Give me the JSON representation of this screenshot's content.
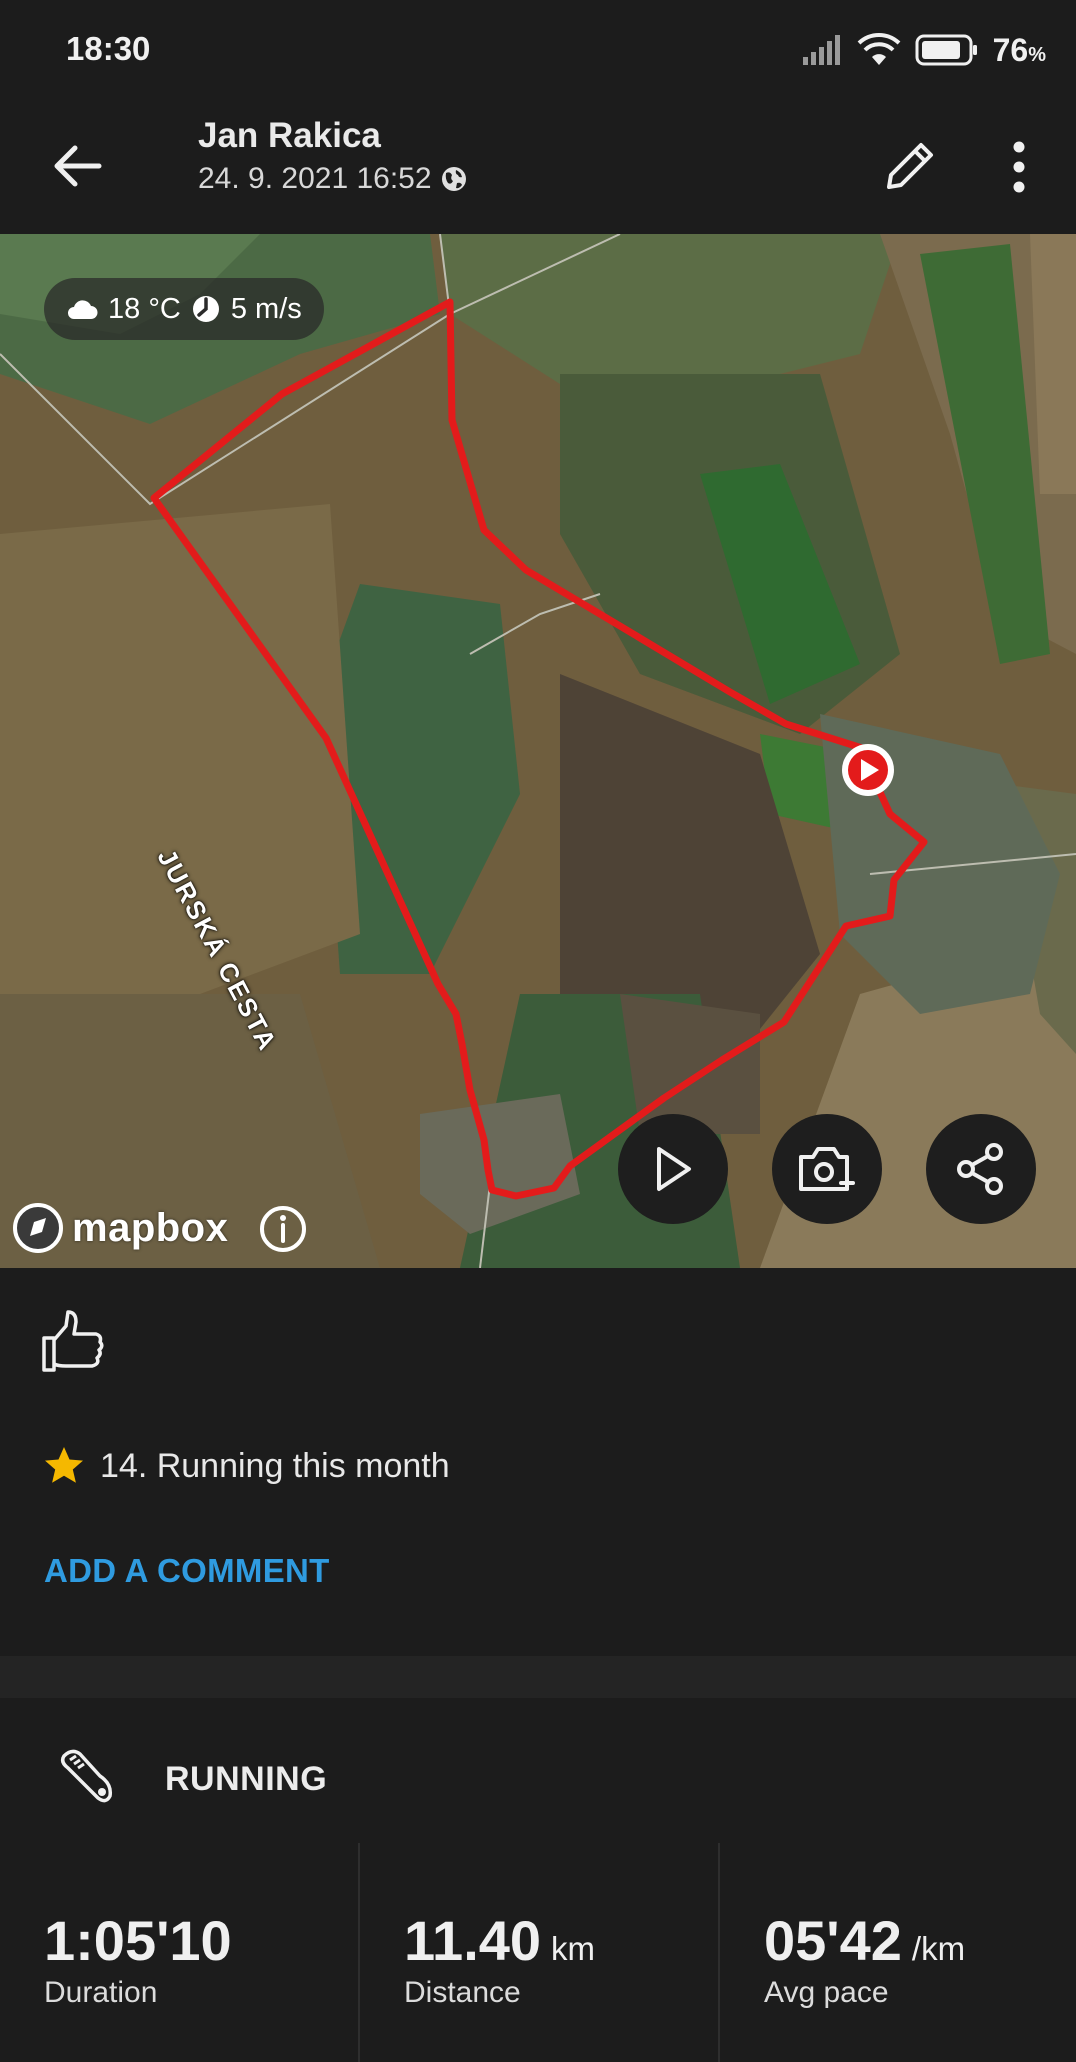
{
  "status_bar": {
    "time": "18:30",
    "battery": "76",
    "battery_unit": "%"
  },
  "header": {
    "title": "Jan Rakica",
    "subtitle": "24. 9. 2021 16:52"
  },
  "map": {
    "temperature": "18 °C",
    "wind": "5 m/s",
    "road_label": "JURSKÁ CESTA",
    "attribution": "mapbox",
    "route_color": "#e31b1b"
  },
  "achievement": "14. Running this month",
  "add_comment": "ADD A COMMENT",
  "activity": {
    "type": "RUNNING",
    "stats": [
      {
        "value": "1:05'10",
        "unit": "",
        "label": "Duration"
      },
      {
        "value": "11.40",
        "unit": "km",
        "label": "Distance"
      },
      {
        "value": "05'42",
        "unit": "/km",
        "label": "Avg pace"
      }
    ]
  },
  "colors": {
    "accent": "#2f9be0",
    "star": "#f5b800",
    "background": "#1c1c1c"
  }
}
